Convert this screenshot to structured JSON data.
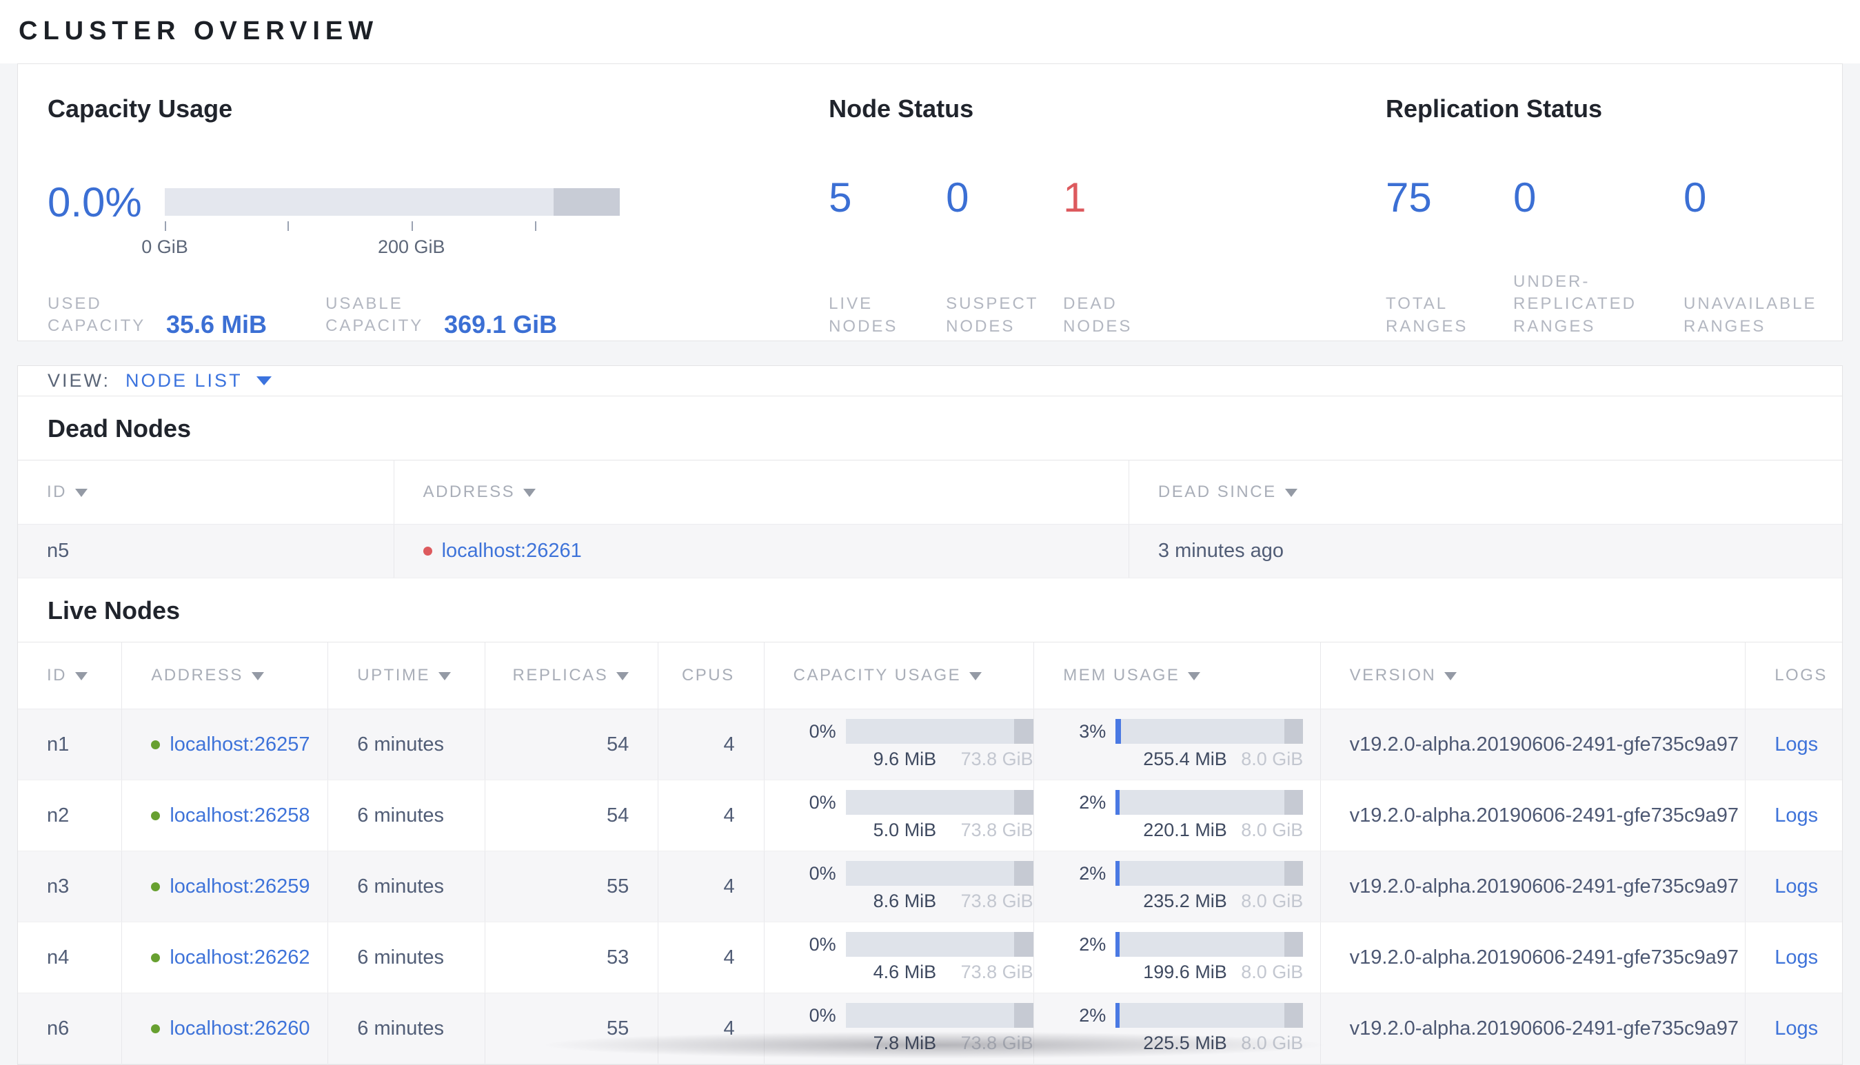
{
  "colors": {
    "accent_blue": "#3b6fd4",
    "link_blue": "#3e73d9",
    "dead_red": "#dd5a5e",
    "live_green": "#67a030"
  },
  "page_title": "CLUSTER OVERVIEW",
  "summary": {
    "capacity": {
      "title": "Capacity Usage",
      "percent": "0.0%",
      "ticks": [
        {
          "pos": 0,
          "label": "0 GiB"
        },
        {
          "pos": 27,
          "label": ""
        },
        {
          "pos": 54,
          "label": "200 GiB"
        },
        {
          "pos": 81,
          "label": ""
        }
      ],
      "used_label": "USED CAPACITY",
      "used_value": "35.6 MiB",
      "usable_label": "USABLE CAPACITY",
      "usable_value": "369.1 GiB"
    },
    "node_status": {
      "title": "Node Status",
      "stats": [
        {
          "value": "5",
          "label": "LIVE NODES",
          "state": "live"
        },
        {
          "value": "0",
          "label": "SUSPECT NODES",
          "state": "suspect"
        },
        {
          "value": "1",
          "label": "DEAD NODES",
          "state": "dead"
        }
      ]
    },
    "replication": {
      "title": "Replication Status",
      "stats": [
        {
          "value": "75",
          "label": "TOTAL RANGES"
        },
        {
          "value": "0",
          "label": "UNDER-REPLICATED RANGES"
        },
        {
          "value": "0",
          "label": "UNAVAILABLE RANGES"
        }
      ]
    }
  },
  "view_bar": {
    "label": "VIEW:",
    "selected": "NODE LIST"
  },
  "dead_nodes": {
    "title": "Dead Nodes",
    "columns": [
      {
        "label": "ID",
        "sortable": true
      },
      {
        "label": "ADDRESS",
        "sortable": true
      },
      {
        "label": "DEAD SINCE",
        "sortable": true
      }
    ],
    "rows": [
      {
        "id": "n5",
        "address": "localhost:26261",
        "dead_since": "3 minutes ago"
      }
    ]
  },
  "live_nodes": {
    "title": "Live Nodes",
    "columns": [
      {
        "label": "ID",
        "sortable": true
      },
      {
        "label": "ADDRESS",
        "sortable": true
      },
      {
        "label": "UPTIME",
        "sortable": true
      },
      {
        "label": "REPLICAS",
        "sortable": true
      },
      {
        "label": "CPUS",
        "sortable": false
      },
      {
        "label": "CAPACITY USAGE",
        "sortable": true
      },
      {
        "label": "MEM USAGE",
        "sortable": true
      },
      {
        "label": "VERSION",
        "sortable": true
      },
      {
        "label": "LOGS",
        "sortable": false
      }
    ],
    "logs_label": "Logs",
    "rows": [
      {
        "id": "n1",
        "address": "localhost:26257",
        "uptime": "6 minutes",
        "replicas": "54",
        "cpus": "4",
        "cap_pct": "0%",
        "cap_fill": 0,
        "cap_used": "9.6 MiB",
        "cap_total": "73.8 GiB",
        "mem_pct": "3%",
        "mem_fill": 3,
        "mem_used": "255.4 MiB",
        "mem_total": "8.0 GiB",
        "version": "v19.2.0-alpha.20190606-2491-gfe735c9a97",
        "logs": "Logs"
      },
      {
        "id": "n2",
        "address": "localhost:26258",
        "uptime": "6 minutes",
        "replicas": "54",
        "cpus": "4",
        "cap_pct": "0%",
        "cap_fill": 0,
        "cap_used": "5.0 MiB",
        "cap_total": "73.8 GiB",
        "mem_pct": "2%",
        "mem_fill": 2,
        "mem_used": "220.1 MiB",
        "mem_total": "8.0 GiB",
        "version": "v19.2.0-alpha.20190606-2491-gfe735c9a97",
        "logs": "Logs"
      },
      {
        "id": "n3",
        "address": "localhost:26259",
        "uptime": "6 minutes",
        "replicas": "55",
        "cpus": "4",
        "cap_pct": "0%",
        "cap_fill": 0,
        "cap_used": "8.6 MiB",
        "cap_total": "73.8 GiB",
        "mem_pct": "2%",
        "mem_fill": 2,
        "mem_used": "235.2 MiB",
        "mem_total": "8.0 GiB",
        "version": "v19.2.0-alpha.20190606-2491-gfe735c9a97",
        "logs": "Logs"
      },
      {
        "id": "n4",
        "address": "localhost:26262",
        "uptime": "6 minutes",
        "replicas": "53",
        "cpus": "4",
        "cap_pct": "0%",
        "cap_fill": 0,
        "cap_used": "4.6 MiB",
        "cap_total": "73.8 GiB",
        "mem_pct": "2%",
        "mem_fill": 2,
        "mem_used": "199.6 MiB",
        "mem_total": "8.0 GiB",
        "version": "v19.2.0-alpha.20190606-2491-gfe735c9a97",
        "logs": "Logs"
      },
      {
        "id": "n6",
        "address": "localhost:26260",
        "uptime": "6 minutes",
        "replicas": "55",
        "cpus": "4",
        "cap_pct": "0%",
        "cap_fill": 0,
        "cap_used": "7.8 MiB",
        "cap_total": "73.8 GiB",
        "mem_pct": "2%",
        "mem_fill": 2,
        "mem_used": "225.5 MiB",
        "mem_total": "8.0 GiB",
        "version": "v19.2.0-alpha.20190606-2491-gfe735c9a97",
        "logs": "Logs"
      }
    ]
  }
}
